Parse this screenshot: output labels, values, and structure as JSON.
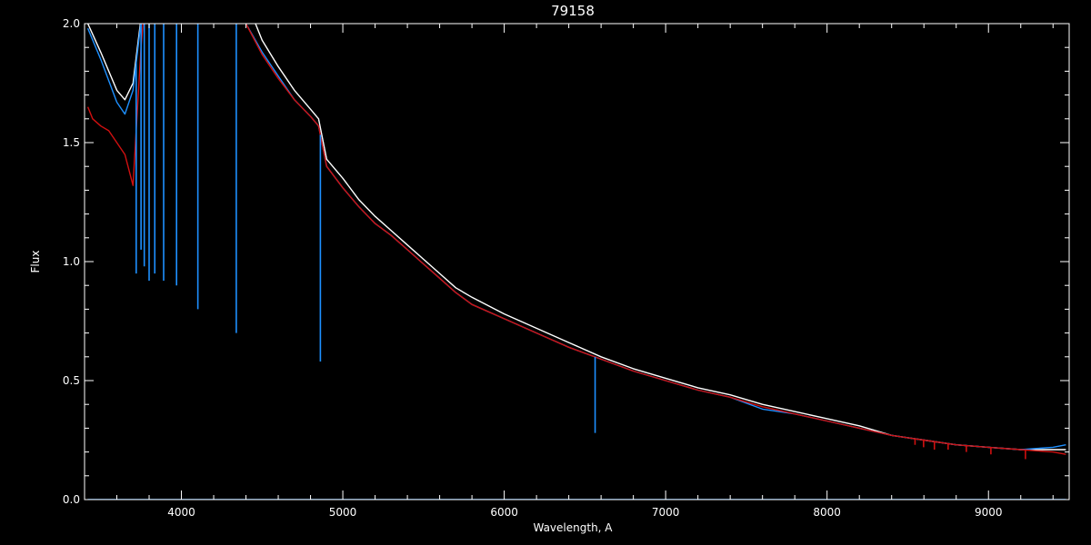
{
  "chart_data": {
    "type": "line",
    "title": "79158",
    "xlabel": "Wavelength, A",
    "ylabel": "Flux",
    "xlim": [
      3400,
      9500
    ],
    "ylim": [
      0.0,
      2.0
    ],
    "x_ticks": [
      {
        "value": 4000,
        "label": "4000"
      },
      {
        "value": 5000,
        "label": "5000"
      },
      {
        "value": 6000,
        "label": "6000"
      },
      {
        "value": 7000,
        "label": "7000"
      },
      {
        "value": 8000,
        "label": "8000"
      },
      {
        "value": 9000,
        "label": "9000"
      }
    ],
    "y_ticks": [
      {
        "value": 0.0,
        "label": "0.0"
      },
      {
        "value": 0.5,
        "label": "0.5"
      },
      {
        "value": 1.0,
        "label": "1.0"
      },
      {
        "value": 1.5,
        "label": "1.5"
      },
      {
        "value": 2.0,
        "label": "2.0"
      }
    ],
    "grid": false,
    "background": "#000000",
    "axis_color": "#ffffff",
    "series": [
      {
        "color": "#ffffff",
        "x": [
          3420,
          3500,
          3600,
          3650,
          3700,
          3800,
          3900,
          4000,
          4100,
          4200,
          4300,
          4400,
          4500,
          4600,
          4700,
          4800,
          4850,
          4900,
          5000,
          5100,
          5200,
          5300,
          5400,
          5500,
          5600,
          5700,
          5800,
          6000,
          6200,
          6400,
          6600,
          6800,
          7000,
          7200,
          7400,
          7600,
          7800,
          8000,
          8200,
          8400,
          8500,
          8600,
          8800,
          9000,
          9200,
          9400,
          9480
        ],
        "y": [
          2.0,
          1.88,
          1.72,
          1.68,
          1.75,
          2.3,
          2.3,
          2.3,
          2.3,
          2.3,
          2.3,
          2.1,
          1.93,
          1.82,
          1.72,
          1.64,
          1.6,
          1.43,
          1.35,
          1.26,
          1.19,
          1.13,
          1.07,
          1.01,
          0.95,
          0.89,
          0.85,
          0.78,
          0.72,
          0.66,
          0.6,
          0.55,
          0.51,
          0.47,
          0.44,
          0.4,
          0.37,
          0.34,
          0.31,
          0.27,
          0.26,
          0.25,
          0.23,
          0.22,
          0.21,
          0.21,
          0.21
        ]
      },
      {
        "color": "#1e90ff",
        "x": [
          3420,
          3500,
          3600,
          3650,
          3700,
          3800,
          3900,
          4000,
          4100,
          4200,
          4300,
          4400,
          4500,
          4600,
          4700,
          4800,
          4850,
          4900,
          5000,
          5100,
          5200,
          5300,
          5400,
          5500,
          5600,
          5700,
          5800,
          6000,
          6200,
          6400,
          6600,
          6800,
          7000,
          7200,
          7400,
          7600,
          7800,
          8000,
          8200,
          8400,
          8500,
          8600,
          8800,
          9000,
          9200,
          9400,
          9480
        ],
        "y": [
          1.98,
          1.85,
          1.67,
          1.62,
          1.72,
          2.3,
          2.3,
          2.3,
          2.3,
          2.3,
          2.3,
          2.0,
          1.88,
          1.78,
          1.68,
          1.61,
          1.57,
          1.4,
          1.31,
          1.23,
          1.16,
          1.11,
          1.05,
          0.99,
          0.93,
          0.87,
          0.82,
          0.76,
          0.7,
          0.64,
          0.59,
          0.54,
          0.5,
          0.46,
          0.43,
          0.38,
          0.36,
          0.33,
          0.3,
          0.27,
          0.26,
          0.25,
          0.23,
          0.22,
          0.21,
          0.22,
          0.23
        ]
      },
      {
        "color": "#d01010",
        "x": [
          3420,
          3450,
          3500,
          3550,
          3600,
          3650,
          3700,
          3750,
          3800,
          3900,
          4000,
          4100,
          4200,
          4300,
          4400,
          4500,
          4600,
          4700,
          4800,
          4850,
          4900,
          5000,
          5100,
          5200,
          5300,
          5400,
          5500,
          5600,
          5700,
          5800,
          6000,
          6200,
          6400,
          6600,
          6800,
          7000,
          7200,
          7400,
          7600,
          7800,
          8000,
          8200,
          8400,
          8500,
          8600,
          8800,
          9000,
          9200,
          9400,
          9480
        ],
        "y": [
          1.65,
          1.6,
          1.57,
          1.55,
          1.5,
          1.45,
          1.32,
          1.9,
          2.3,
          2.3,
          2.3,
          2.3,
          2.3,
          2.3,
          2.0,
          1.87,
          1.77,
          1.68,
          1.61,
          1.57,
          1.4,
          1.31,
          1.23,
          1.16,
          1.11,
          1.05,
          0.99,
          0.93,
          0.87,
          0.82,
          0.76,
          0.7,
          0.64,
          0.59,
          0.54,
          0.5,
          0.46,
          0.43,
          0.39,
          0.36,
          0.33,
          0.3,
          0.27,
          0.26,
          0.25,
          0.23,
          0.22,
          0.21,
          0.2,
          0.19
        ]
      },
      {
        "color": "#1e90ff",
        "x": [
          3420,
          9480
        ],
        "y": [
          0.0,
          0.0
        ]
      }
    ],
    "absorption_lines": [
      {
        "x": 3720,
        "depth_to": 0.95,
        "color": "#1e90ff"
      },
      {
        "x": 3750,
        "depth_to": 1.05,
        "color": "#1e90ff"
      },
      {
        "x": 3770,
        "depth_to": 0.98,
        "color": "#1e90ff"
      },
      {
        "x": 3800,
        "depth_to": 0.92,
        "color": "#1e90ff"
      },
      {
        "x": 3835,
        "depth_to": 0.95,
        "color": "#1e90ff"
      },
      {
        "x": 3890,
        "depth_to": 0.92,
        "color": "#1e90ff"
      },
      {
        "x": 3970,
        "depth_to": 0.9,
        "color": "#1e90ff"
      },
      {
        "x": 4102,
        "depth_to": 0.8,
        "color": "#1e90ff"
      },
      {
        "x": 4340,
        "depth_to": 0.7,
        "color": "#1e90ff"
      },
      {
        "x": 4861,
        "depth_to": 0.58,
        "color": "#1e90ff"
      },
      {
        "x": 6563,
        "depth_to": 0.28,
        "color": "#1e90ff"
      },
      {
        "x": 8545,
        "depth_to": 0.23,
        "color": "#d01010"
      },
      {
        "x": 8598,
        "depth_to": 0.22,
        "color": "#d01010"
      },
      {
        "x": 8665,
        "depth_to": 0.21,
        "color": "#d01010"
      },
      {
        "x": 8750,
        "depth_to": 0.21,
        "color": "#d01010"
      },
      {
        "x": 8863,
        "depth_to": 0.2,
        "color": "#d01010"
      },
      {
        "x": 9015,
        "depth_to": 0.19,
        "color": "#d01010"
      },
      {
        "x": 9229,
        "depth_to": 0.17,
        "color": "#d01010"
      }
    ]
  }
}
